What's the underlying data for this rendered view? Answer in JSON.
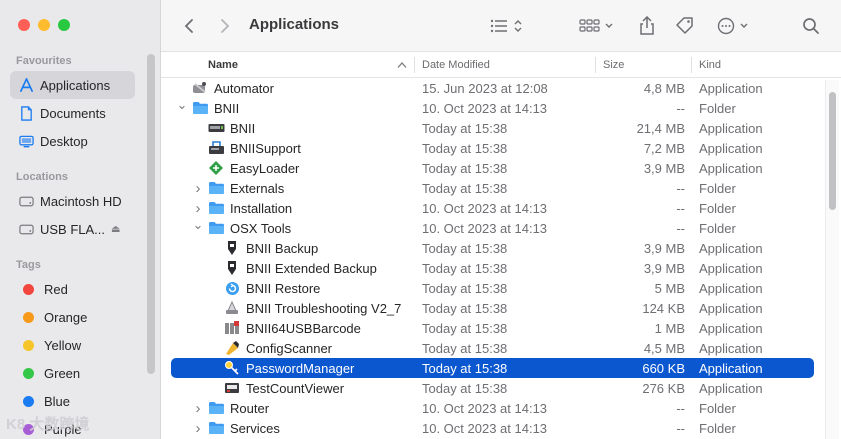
{
  "sidebar": {
    "window_controls": {
      "close_color": "#ff5f57",
      "minimize_color": "#febc2e",
      "zoom_color": "#28c840"
    },
    "favourites_title": "Favourites",
    "favourites": [
      {
        "label": "Applications",
        "icon": "applications-icon",
        "selected": true
      },
      {
        "label": "Documents",
        "icon": "document-icon",
        "selected": false
      },
      {
        "label": "Desktop",
        "icon": "desktop-icon",
        "selected": false
      }
    ],
    "locations_title": "Locations",
    "locations": [
      {
        "label": "Macintosh HD",
        "icon": "disk-icon"
      },
      {
        "label": "USB FLA...",
        "icon": "disk-icon",
        "eject": true
      }
    ],
    "tags_title": "Tags",
    "tags": [
      {
        "label": "Red",
        "color": "#f2453d"
      },
      {
        "label": "Orange",
        "color": "#f79a1c"
      },
      {
        "label": "Yellow",
        "color": "#f5c52a"
      },
      {
        "label": "Green",
        "color": "#34c748"
      },
      {
        "label": "Blue",
        "color": "#1b7cf2"
      },
      {
        "label": "Purple",
        "color": "#a65dd6"
      }
    ],
    "watermark": "K8 大数跨境"
  },
  "toolbar": {
    "title": "Applications"
  },
  "columns": {
    "name": "Name",
    "date": "Date Modified",
    "size": "Size",
    "kind": "Kind"
  },
  "rows": [
    {
      "level": 0,
      "chevron": "",
      "icon": "automator-app-icon",
      "name": "Automator",
      "date": "15. Jun 2023 at 12:08",
      "size": "4,8 MB",
      "kind": "Application",
      "selected": false
    },
    {
      "level": 0,
      "chevron": "down",
      "icon": "folder-icon",
      "name": "BNII",
      "date": "10. Oct 2023 at 14:13",
      "size": "--",
      "kind": "Folder",
      "selected": false
    },
    {
      "level": 1,
      "chevron": "",
      "icon": "bnii-app-icon",
      "name": "BNII",
      "date": "Today at 15:38",
      "size": "21,4 MB",
      "kind": "Application",
      "selected": false
    },
    {
      "level": 1,
      "chevron": "",
      "icon": "bniisupport-app-icon",
      "name": "BNIISupport",
      "date": "Today at 15:38",
      "size": "7,2 MB",
      "kind": "Application",
      "selected": false
    },
    {
      "level": 1,
      "chevron": "",
      "icon": "easyloader-app-icon",
      "name": "EasyLoader",
      "date": "Today at 15:38",
      "size": "3,9 MB",
      "kind": "Application",
      "selected": false
    },
    {
      "level": 1,
      "chevron": "right",
      "icon": "folder-icon",
      "name": "Externals",
      "date": "Today at 15:38",
      "size": "--",
      "kind": "Folder",
      "selected": false
    },
    {
      "level": 1,
      "chevron": "right",
      "icon": "folder-icon",
      "name": "Installation",
      "date": "10. Oct 2023 at 14:13",
      "size": "--",
      "kind": "Folder",
      "selected": false
    },
    {
      "level": 1,
      "chevron": "down",
      "icon": "folder-icon",
      "name": "OSX Tools",
      "date": "10. Oct 2023 at 14:13",
      "size": "--",
      "kind": "Folder",
      "selected": false
    },
    {
      "level": 2,
      "chevron": "",
      "icon": "backup-app-icon",
      "name": "BNII Backup",
      "date": "Today at 15:38",
      "size": "3,9 MB",
      "kind": "Application",
      "selected": false
    },
    {
      "level": 2,
      "chevron": "",
      "icon": "backup-app-icon",
      "name": "BNII Extended Backup",
      "date": "Today at 15:38",
      "size": "3,9 MB",
      "kind": "Application",
      "selected": false
    },
    {
      "level": 2,
      "chevron": "",
      "icon": "restore-app-icon",
      "name": "BNII Restore",
      "date": "Today at 15:38",
      "size": "5 MB",
      "kind": "Application",
      "selected": false
    },
    {
      "level": 2,
      "chevron": "",
      "icon": "troubleshooting-app-icon",
      "name": "BNII Troubleshooting V2_7",
      "date": "Today at 15:38",
      "size": "124 KB",
      "kind": "Application",
      "selected": false
    },
    {
      "level": 2,
      "chevron": "",
      "icon": "barcode-app-icon",
      "name": "BNII64USBBarcode",
      "date": "Today at 15:38",
      "size": "1 MB",
      "kind": "Application",
      "selected": false
    },
    {
      "level": 2,
      "chevron": "",
      "icon": "configscanner-app-icon",
      "name": "ConfigScanner",
      "date": "Today at 15:38",
      "size": "4,5 MB",
      "kind": "Application",
      "selected": false
    },
    {
      "level": 2,
      "chevron": "",
      "icon": "key-app-icon",
      "name": "PasswordManager",
      "date": "Today at 15:38",
      "size": "660 KB",
      "kind": "Application",
      "selected": true
    },
    {
      "level": 2,
      "chevron": "",
      "icon": "counter-app-icon",
      "name": "TestCountViewer",
      "date": "Today at 15:38",
      "size": "276 KB",
      "kind": "Application",
      "selected": false
    },
    {
      "level": 1,
      "chevron": "right",
      "icon": "folder-icon",
      "name": "Router",
      "date": "10. Oct 2023 at 14:13",
      "size": "--",
      "kind": "Folder",
      "selected": false
    },
    {
      "level": 1,
      "chevron": "right",
      "icon": "folder-icon",
      "name": "Services",
      "date": "10. Oct 2023 at 14:13",
      "size": "--",
      "kind": "Folder",
      "selected": false
    }
  ]
}
